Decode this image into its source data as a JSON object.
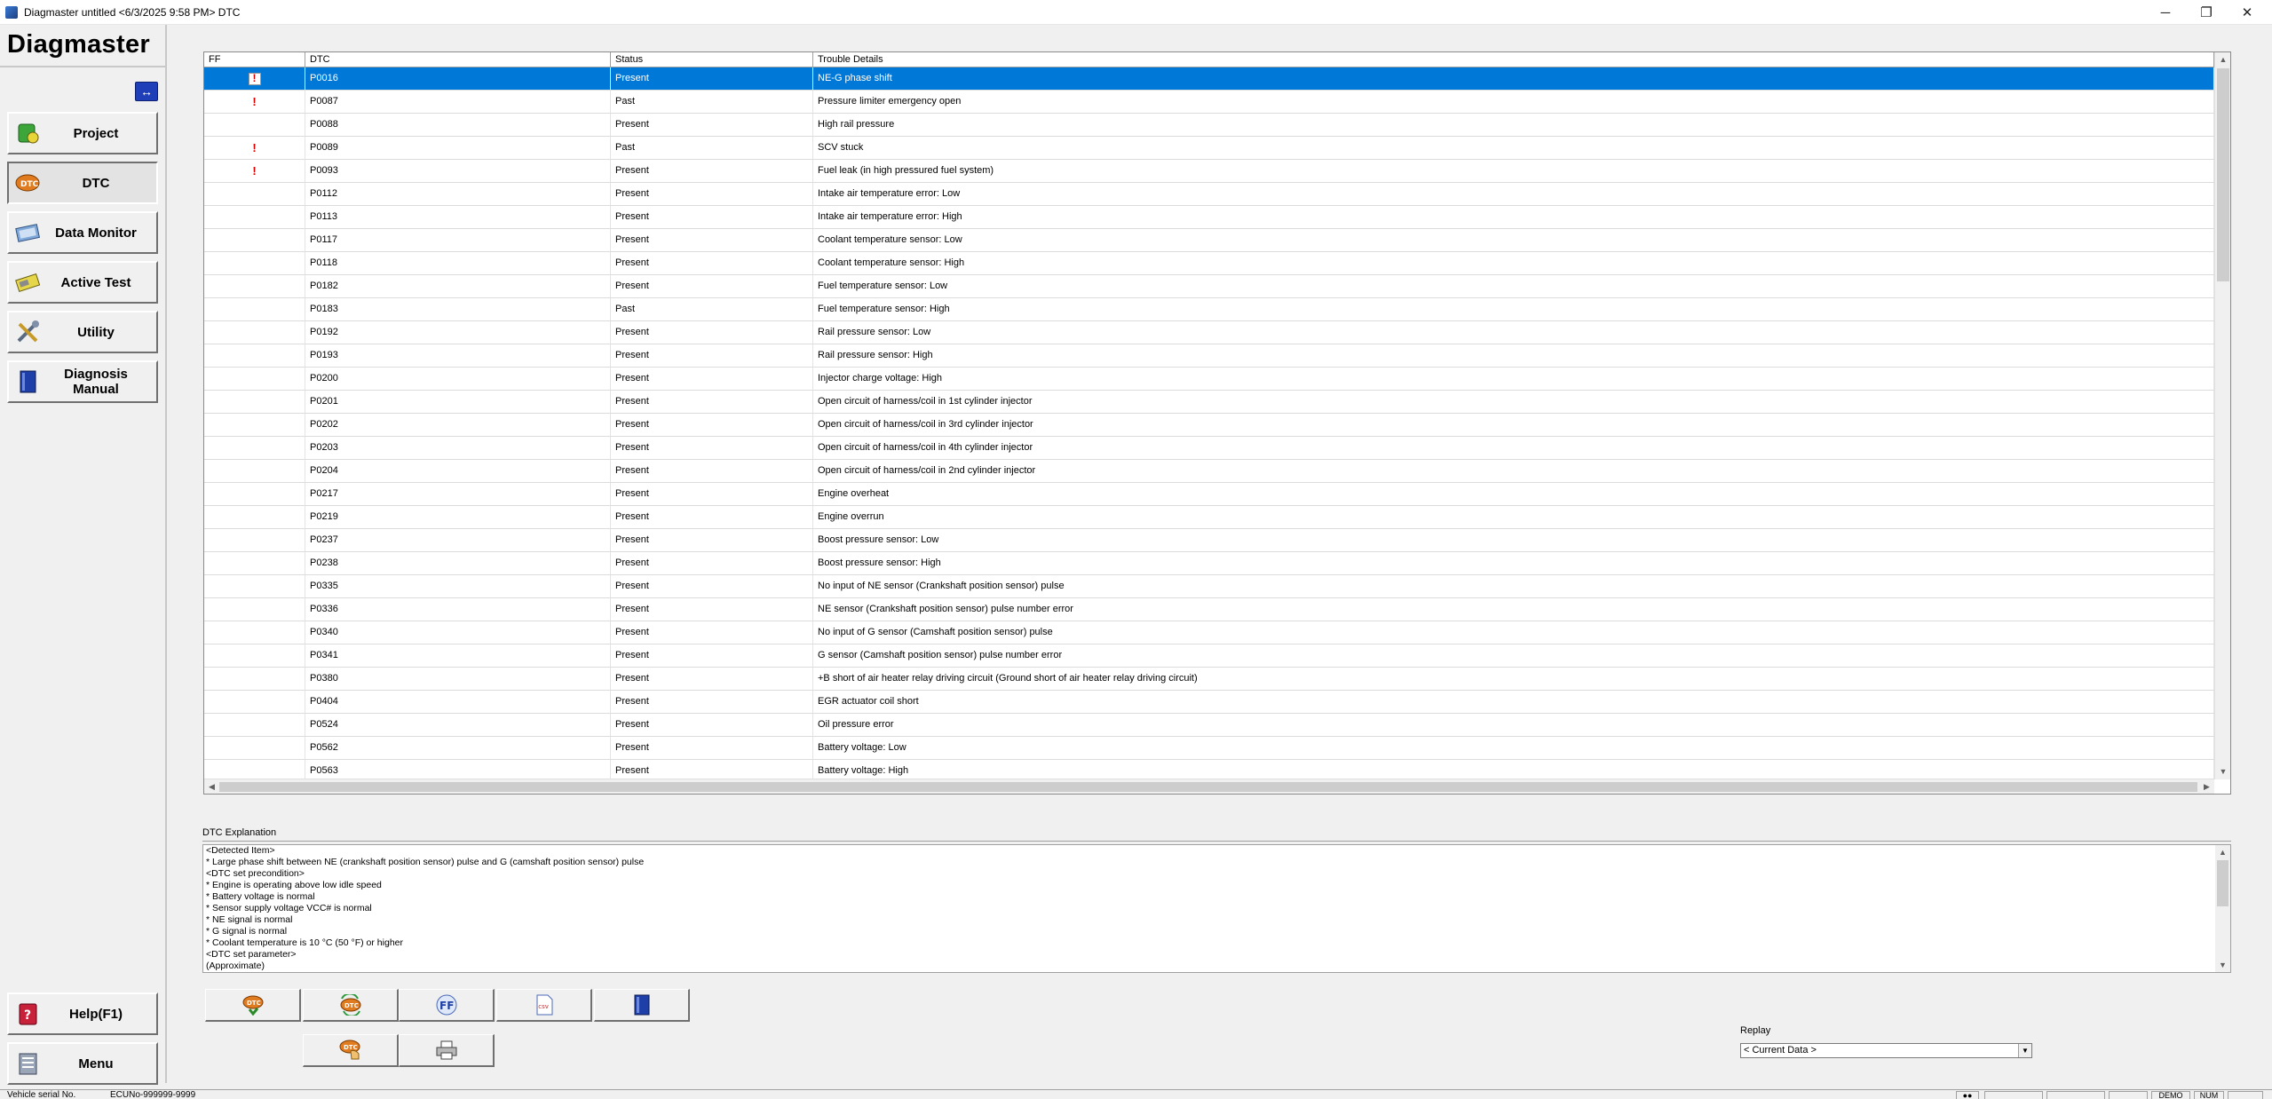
{
  "window": {
    "title": "Diagmaster untitled <6/3/2025 9:58 PM> DTC",
    "minimize": "─",
    "restore": "❐",
    "close": "✕"
  },
  "sidebar": {
    "logo": "Diagmaster",
    "toggle_glyph": "↔",
    "nav": [
      {
        "label": "Project",
        "icon": "project-icon",
        "active": false
      },
      {
        "label": "DTC",
        "icon": "dtc-icon",
        "active": true
      },
      {
        "label": "Data Monitor",
        "icon": "data-monitor-icon",
        "active": false
      },
      {
        "label": "Active Test",
        "icon": "active-test-icon",
        "active": false
      },
      {
        "label": "Utility",
        "icon": "utility-icon",
        "active": false
      },
      {
        "label": "Diagnosis Manual",
        "icon": "manual-icon",
        "active": false
      }
    ],
    "help_label": "Help(F1)",
    "menu_label": "Menu"
  },
  "grid": {
    "columns": [
      "FF",
      "DTC",
      "Status",
      "Trouble Details"
    ],
    "rows": [
      {
        "ff": "!",
        "ff_boxed": true,
        "dtc": "P0016",
        "status": "Present",
        "details": "NE-G phase shift",
        "selected": true
      },
      {
        "ff": "!",
        "dtc": "P0087",
        "status": "Past",
        "details": "Pressure limiter emergency open"
      },
      {
        "ff": "",
        "dtc": "P0088",
        "status": "Present",
        "details": "High rail pressure"
      },
      {
        "ff": "!",
        "dtc": "P0089",
        "status": "Past",
        "details": "SCV stuck"
      },
      {
        "ff": "!",
        "dtc": "P0093",
        "status": "Present",
        "details": "Fuel leak (in high pressured fuel system)"
      },
      {
        "ff": "",
        "dtc": "P0112",
        "status": "Present",
        "details": "Intake air temperature error: Low"
      },
      {
        "ff": "",
        "dtc": "P0113",
        "status": "Present",
        "details": "Intake air temperature error: High"
      },
      {
        "ff": "",
        "dtc": "P0117",
        "status": "Present",
        "details": "Coolant temperature sensor: Low"
      },
      {
        "ff": "",
        "dtc": "P0118",
        "status": "Present",
        "details": "Coolant temperature sensor: High"
      },
      {
        "ff": "",
        "dtc": "P0182",
        "status": "Present",
        "details": "Fuel temperature sensor: Low"
      },
      {
        "ff": "",
        "dtc": "P0183",
        "status": "Past",
        "details": "Fuel temperature sensor: High"
      },
      {
        "ff": "",
        "dtc": "P0192",
        "status": "Present",
        "details": "Rail pressure sensor: Low"
      },
      {
        "ff": "",
        "dtc": "P0193",
        "status": "Present",
        "details": "Rail pressure sensor: High"
      },
      {
        "ff": "",
        "dtc": "P0200",
        "status": "Present",
        "details": "Injector charge voltage: High"
      },
      {
        "ff": "",
        "dtc": "P0201",
        "status": "Present",
        "details": "Open circuit of harness/coil in 1st cylinder injector"
      },
      {
        "ff": "",
        "dtc": "P0202",
        "status": "Present",
        "details": "Open circuit of harness/coil in 3rd cylinder injector"
      },
      {
        "ff": "",
        "dtc": "P0203",
        "status": "Present",
        "details": "Open circuit of harness/coil in 4th cylinder injector"
      },
      {
        "ff": "",
        "dtc": "P0204",
        "status": "Present",
        "details": "Open circuit of harness/coil in 2nd cylinder injector"
      },
      {
        "ff": "",
        "dtc": "P0217",
        "status": "Present",
        "details": "Engine overheat"
      },
      {
        "ff": "",
        "dtc": "P0219",
        "status": "Present",
        "details": "Engine overrun"
      },
      {
        "ff": "",
        "dtc": "P0237",
        "status": "Present",
        "details": "Boost pressure sensor: Low"
      },
      {
        "ff": "",
        "dtc": "P0238",
        "status": "Present",
        "details": "Boost pressure sensor: High"
      },
      {
        "ff": "",
        "dtc": "P0335",
        "status": "Present",
        "details": "No input of NE sensor (Crankshaft position sensor) pulse"
      },
      {
        "ff": "",
        "dtc": "P0336",
        "status": "Present",
        "details": "NE sensor (Crankshaft position sensor) pulse number error"
      },
      {
        "ff": "",
        "dtc": "P0340",
        "status": "Present",
        "details": "No input of G sensor (Camshaft position sensor) pulse"
      },
      {
        "ff": "",
        "dtc": "P0341",
        "status": "Present",
        "details": "G sensor (Camshaft position sensor) pulse number error"
      },
      {
        "ff": "",
        "dtc": "P0380",
        "status": "Present",
        "details": "+B short of air heater relay driving circuit (Ground short of air heater relay driving circuit)"
      },
      {
        "ff": "",
        "dtc": "P0404",
        "status": "Present",
        "details": "EGR actuator coil short"
      },
      {
        "ff": "",
        "dtc": "P0524",
        "status": "Present",
        "details": "Oil pressure error"
      },
      {
        "ff": "",
        "dtc": "P0562",
        "status": "Present",
        "details": "Battery voltage: Low"
      },
      {
        "ff": "",
        "dtc": "P0563",
        "status": "Present",
        "details": "Battery voltage: High"
      }
    ]
  },
  "explanation": {
    "label": "DTC Explanation",
    "lines": [
      "<Detected Item>",
      "* Large phase shift between NE (crankshaft position sensor) pulse and G (camshaft position sensor) pulse",
      "<DTC set precondition>",
      "* Engine is operating above low idle speed",
      "* Battery voltage is normal",
      "* Sensor supply voltage VCC# is normal",
      "* NE signal is normal",
      "* G signal is normal",
      "* Coolant temperature is 10 °C (50 °F) or higher",
      "<DTC set parameter>",
      "(Approximate)"
    ]
  },
  "toolbar": {
    "buttons": [
      {
        "name": "read-dtc-button",
        "icon": "dtc-read-icon"
      },
      {
        "name": "clear-dtc-button",
        "icon": "dtc-clear-icon"
      },
      {
        "name": "freeze-frame-button",
        "icon": "ff-icon",
        "text": "FF"
      },
      {
        "name": "export-csv-button",
        "icon": "csv-icon",
        "text": ".csv"
      },
      {
        "name": "manual-button",
        "icon": "manual-book-icon"
      },
      {
        "name": "dtc-history-button",
        "icon": "dtc-hand-icon"
      },
      {
        "name": "print-button",
        "icon": "printer-icon"
      }
    ]
  },
  "replay": {
    "label": "Replay",
    "value": "< Current Data >"
  },
  "statusbar": {
    "vehicle_serial": "Vehicle serial No.",
    "ecu": "ECUNo-999999-9999",
    "demo": "DEMO",
    "num": "NUM"
  }
}
